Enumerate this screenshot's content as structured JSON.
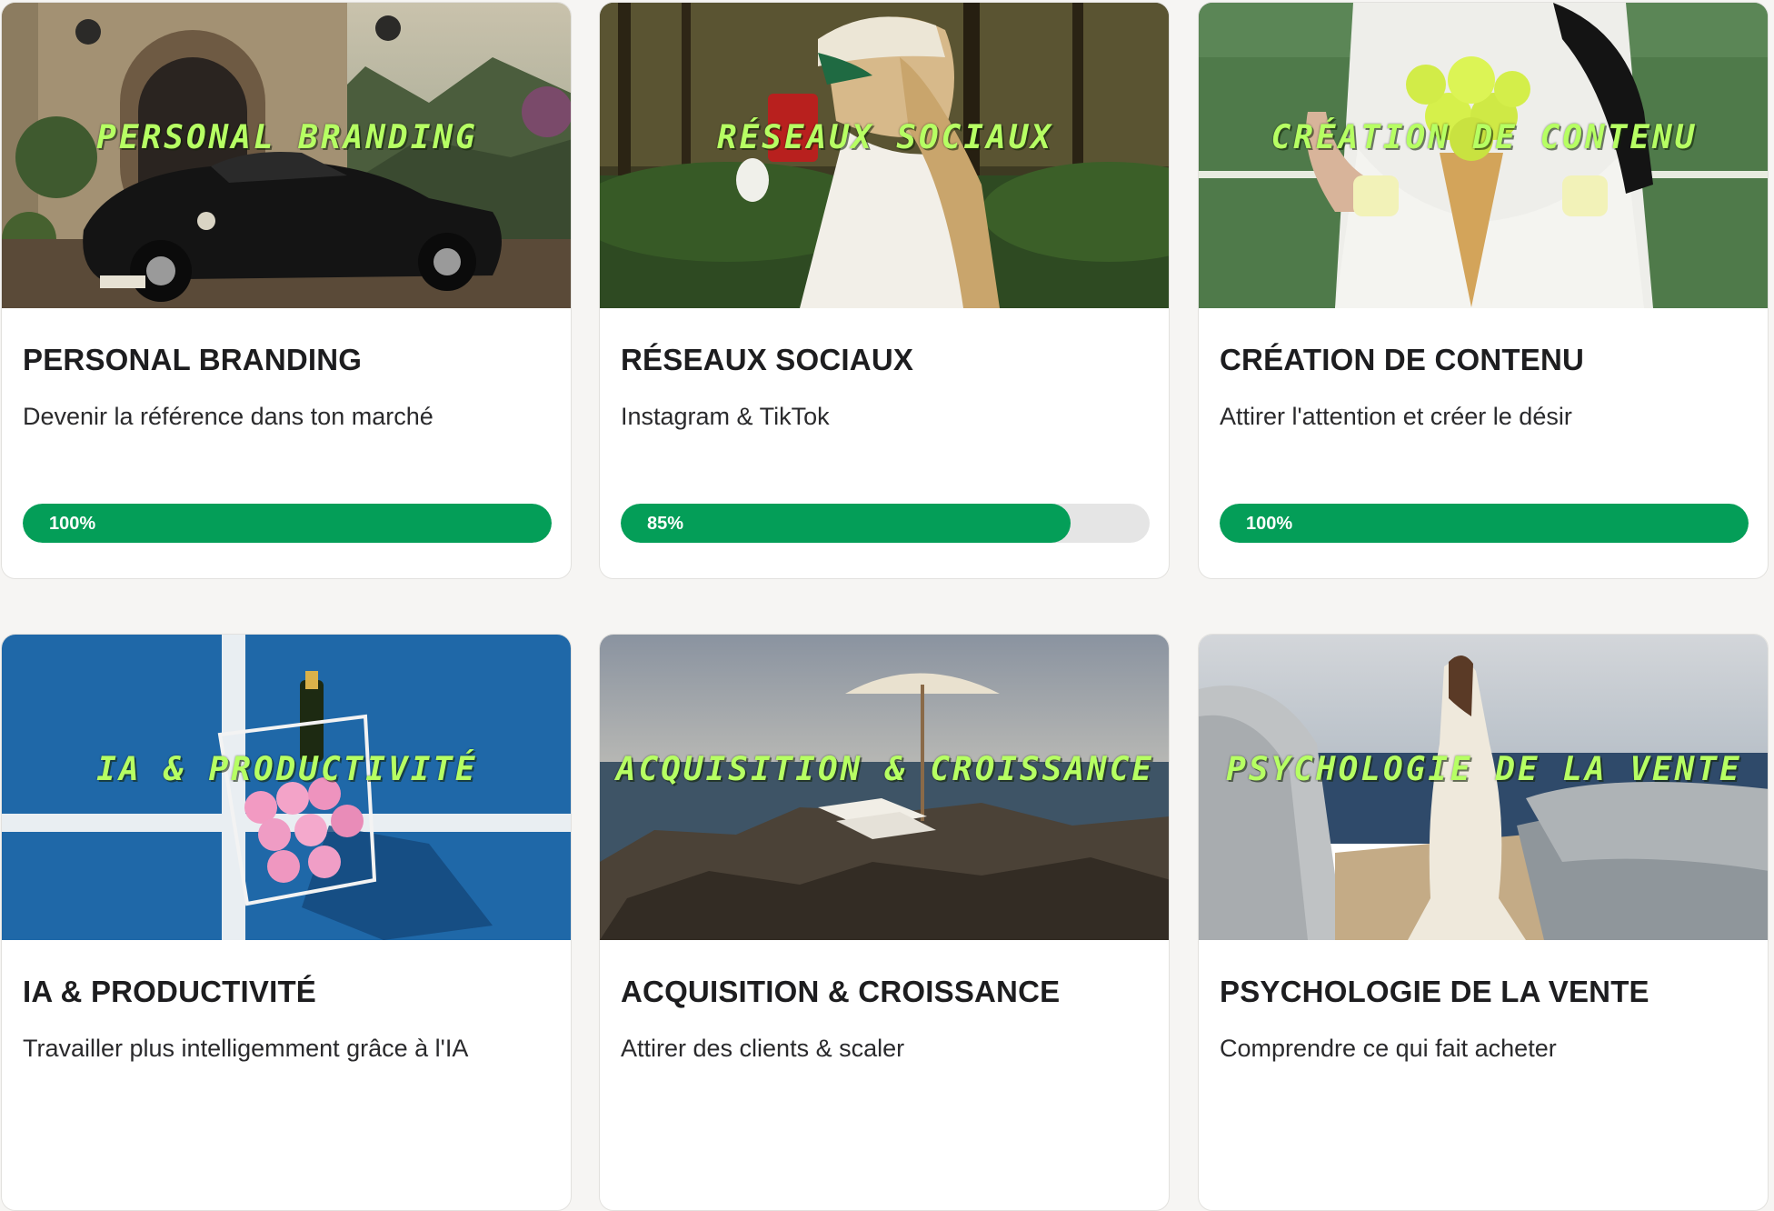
{
  "courses": [
    {
      "overlay": "Personal Branding",
      "title": "PERSONAL BRANDING",
      "description": "Devenir la référence dans ton marché",
      "progress": 100,
      "progress_label": "100%",
      "image": "vintage-car-villa-photo"
    },
    {
      "overlay": "Réseaux Sociaux",
      "title": "RÉSEAUX SOCIAUX",
      "description": "Instagram & TikTok",
      "progress": 85,
      "progress_label": "85%",
      "image": "woman-drinking-cap-photo"
    },
    {
      "overlay": "Création de Contenu",
      "title": "CRÉATION DE CONTENU",
      "description": "Attirer l'attention et créer le désir",
      "progress": 100,
      "progress_label": "100%",
      "image": "tennis-ball-cone-photo"
    },
    {
      "overlay": "IA & Productivité",
      "title": "IA & PRODUCTIVITÉ",
      "description": "Travailler plus intelligemment grâce à l'IA",
      "image": "tennis-basket-champagne-photo"
    },
    {
      "overlay": "Acquisition & Croissance",
      "title": "ACQUISITION & CROISSANCE",
      "description": "Attirer des clients & scaler",
      "image": "beach-umbrella-rocks-photo"
    },
    {
      "overlay": "Psychologie de la Vente",
      "title": "PSYCHOLOGIE DE LA VENTE",
      "description": "Comprendre ce qui fait acheter",
      "image": "woman-yacht-sea-photo"
    }
  ],
  "colors": {
    "progress_fill": "#049e58",
    "progress_track": "#e5e5e5",
    "overlay_text": "#b6ff63",
    "page_background": "#f6f5f3"
  }
}
